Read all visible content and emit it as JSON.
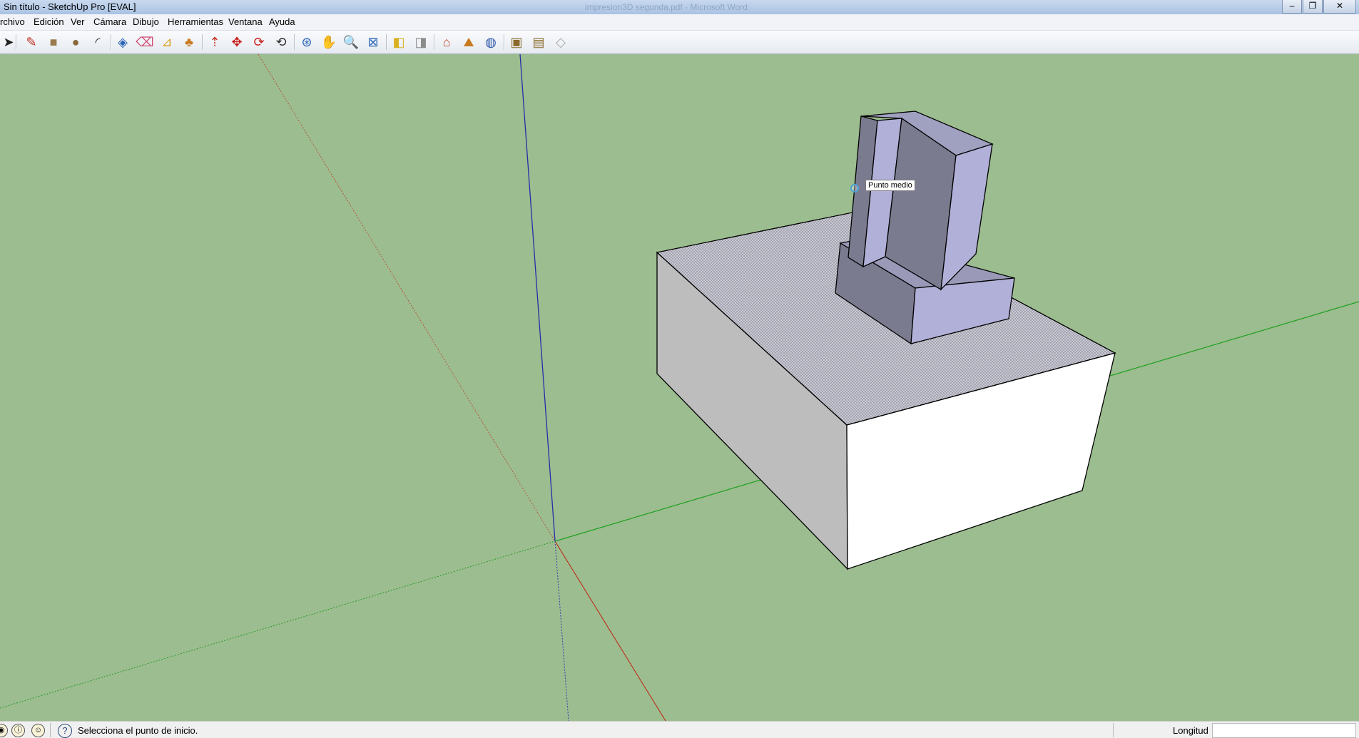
{
  "window": {
    "title": "Sin título - SketchUp Pro [EVAL]",
    "background_title": "impresion3D segunda.pdf - Microsoft Word",
    "minimize": "–",
    "restore": "❐",
    "close": "✕"
  },
  "menu": [
    "rchivo",
    "Edición",
    "Ver",
    "Cámara",
    "Dibujo",
    "Herramientas",
    "Ventana",
    "Ayuda"
  ],
  "toolbar": {
    "tools": [
      {
        "name": "select-tool",
        "icon": "arrow",
        "glyph": "➤",
        "color": "#222222"
      },
      {
        "name": "line-tool",
        "icon": "pencil",
        "glyph": "✎",
        "color": "#c03020"
      },
      {
        "name": "rectangle-tool",
        "icon": "rectangle",
        "glyph": "■",
        "color": "#9a7b4f"
      },
      {
        "name": "circle-tool",
        "icon": "circle",
        "glyph": "●",
        "color": "#8a6a3a"
      },
      {
        "name": "arc-tool",
        "icon": "arc",
        "glyph": "◜",
        "color": "#333333"
      },
      {
        "name": "make-component-tool",
        "icon": "component",
        "glyph": "◈",
        "color": "#2a66b8"
      },
      {
        "name": "eraser-tool",
        "icon": "eraser",
        "glyph": "⌫",
        "color": "#d04a70"
      },
      {
        "name": "tape-measure-tool",
        "icon": "tape",
        "glyph": "⊿",
        "color": "#d8a020"
      },
      {
        "name": "paint-bucket-tool",
        "icon": "bucket",
        "glyph": "♣",
        "color": "#c87a20"
      },
      {
        "name": "push-pull-tool",
        "icon": "push-pull",
        "glyph": "⇡",
        "color": "#c83020"
      },
      {
        "name": "move-tool",
        "icon": "move",
        "glyph": "✥",
        "color": "#c82020"
      },
      {
        "name": "rotate-tool",
        "icon": "rotate",
        "glyph": "⟳",
        "color": "#c82020"
      },
      {
        "name": "offset-tool",
        "icon": "offset",
        "glyph": "⟲",
        "color": "#333333"
      },
      {
        "name": "orbit-tool",
        "icon": "orbit",
        "glyph": "⊛",
        "color": "#2a66b8"
      },
      {
        "name": "pan-tool",
        "icon": "hand",
        "glyph": "✋",
        "color": "#555555"
      },
      {
        "name": "zoom-tool",
        "icon": "magnifier",
        "glyph": "🔍",
        "color": "#333333"
      },
      {
        "name": "zoom-extents-tool",
        "icon": "zoom-extents",
        "glyph": "⊠",
        "color": "#2a66b8"
      },
      {
        "name": "previous-view-tool",
        "icon": "previous",
        "glyph": "◧",
        "color": "#d8b020"
      },
      {
        "name": "next-view-tool",
        "icon": "next",
        "glyph": "◨",
        "color": "#8a8a8a"
      },
      {
        "name": "add-location-tool",
        "icon": "location",
        "glyph": "⌂",
        "color": "#b84020"
      },
      {
        "name": "toggle-terrain-tool",
        "icon": "terrain",
        "glyph": "⛰",
        "color": "#c87a20"
      },
      {
        "name": "3d-warehouse-tool",
        "icon": "globe",
        "glyph": "◍",
        "color": "#2a55a8"
      },
      {
        "name": "get-models-tool",
        "icon": "get-models",
        "glyph": "▣",
        "color": "#8a6a2a"
      },
      {
        "name": "share-model-tool",
        "icon": "share-model",
        "glyph": "▤",
        "color": "#8a6a2a"
      },
      {
        "name": "extension-warehouse-tool",
        "icon": "extensions",
        "glyph": "◇",
        "color": "#aaaaaa"
      }
    ]
  },
  "viewport": {
    "sky_color": "#9cbd8f",
    "tooltip": "Punto medio"
  },
  "status": {
    "message": "Selecciona el punto de inicio.",
    "measurement_label": "Longitud",
    "measurement_value": "",
    "icons": [
      "geo-location-icon",
      "credits-icon",
      "user-icon"
    ],
    "icon_glyphs": [
      "◉",
      "ⓘ",
      "☺"
    ],
    "help_glyph": "?"
  }
}
